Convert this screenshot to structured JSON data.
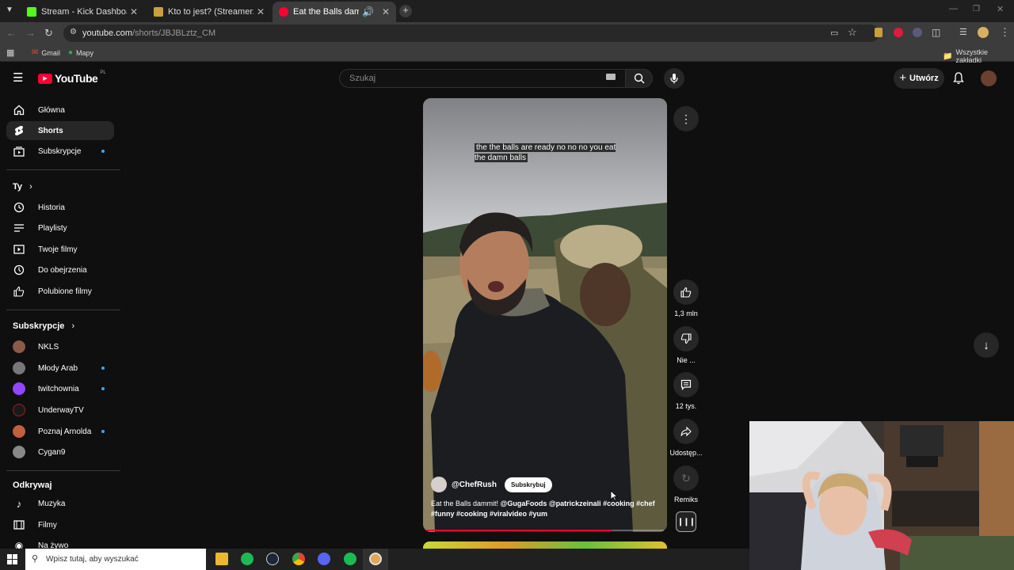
{
  "browser": {
    "tabs": [
      {
        "title": "Stream - Kick Dashboard",
        "favicon_color": "#53fc18"
      },
      {
        "title": "Kto to jest? (Streamerzy) - Zagá",
        "favicon_color": "#c8a040"
      },
      {
        "title": "Eat the Balls dammit! @Gu",
        "favicon_color": "#ff0033",
        "active": true
      }
    ],
    "url": {
      "host": "youtube.com",
      "path": "/shorts/JBJBLztz_CM"
    },
    "bookmarks": [
      {
        "label": "Gmail"
      },
      {
        "label": "Mapy"
      }
    ],
    "all_bookmarks_label": "Wszystkie zakładki"
  },
  "youtube": {
    "logo_text": "YouTube",
    "region": "PL",
    "search_placeholder": "Szukaj",
    "create_label": "Utwórz",
    "accent": "#ff0033"
  },
  "sidebar": {
    "main": [
      {
        "label": "Główna",
        "icon": "home-icon"
      },
      {
        "label": "Shorts",
        "icon": "shorts-icon",
        "active": true
      },
      {
        "label": "Subskrypcje",
        "icon": "subscriptions-icon"
      }
    ],
    "you_heading": "Ty",
    "you": [
      {
        "label": "Historia",
        "icon": "history-icon"
      },
      {
        "label": "Playlisty",
        "icon": "playlists-icon"
      },
      {
        "label": "Twoje filmy",
        "icon": "your-videos-icon"
      },
      {
        "label": "Do obejrzenia",
        "icon": "watch-later-icon"
      },
      {
        "label": "Polubione filmy",
        "icon": "liked-icon"
      }
    ],
    "subs_heading": "Subskrypcje",
    "subs": [
      {
        "label": "NKLS",
        "color": "#8a5a4a"
      },
      {
        "label": "Młody Arab",
        "color": "#777"
      },
      {
        "label": "twitchownia",
        "color": "#9146ff"
      },
      {
        "label": "UnderwayTV",
        "color": "#1a1a1a"
      },
      {
        "label": "Poznaj Arnolda",
        "color": "#c06040"
      },
      {
        "label": "Cygan9",
        "color": "#888"
      }
    ],
    "explore_heading": "Odkrywaj",
    "explore": [
      {
        "label": "Muzyka",
        "icon": "music-icon"
      },
      {
        "label": "Filmy",
        "icon": "films-icon"
      },
      {
        "label": "Na żywo",
        "icon": "live-icon"
      }
    ]
  },
  "short": {
    "caption": "the the balls are ready no no no you eat the damn balls",
    "channel": "@ChefRush",
    "subscribe_label": "Subskrybuj",
    "title_text": "Eat the Balls dammit! ",
    "tags": "@GugaFoods @patrickzeinali #cooking #chef #funny #cooking #viralvideo #yum",
    "progress": 0.78
  },
  "actions": {
    "like": "1,3 mln",
    "dislike": "Nie ...",
    "comments": "12 tys.",
    "share": "Udostęp...",
    "remix": "Remiks"
  },
  "taskbar": {
    "search_placeholder": "Wpisz tutaj, aby wyszukać"
  }
}
